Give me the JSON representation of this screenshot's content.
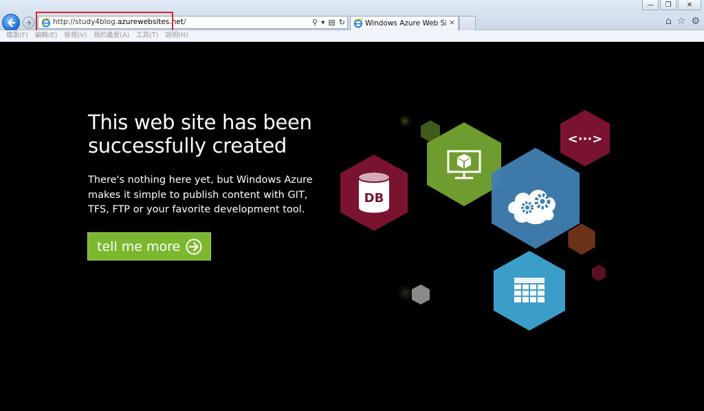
{
  "browser": {
    "url_prefix": "http://study4blog.",
    "url_host": "azurewebsites.net",
    "url_suffix": "/",
    "tab_title": "Windows Azure Web Site ...",
    "tab_close": "×",
    "search_glyph": "⚲",
    "compat_glyph": "▤",
    "refresh_glyph": "↻",
    "window_buttons": {
      "minimize": "—",
      "restore": "❐",
      "close": "✕"
    },
    "toolbar_icons": {
      "home": "⌂",
      "favorites": "☆",
      "tools": "⚙"
    },
    "menu": [
      "檔案(F)",
      "編輯(E)",
      "檢視(V)",
      "我的最愛(A)",
      "工具(T)",
      "說明(H)"
    ]
  },
  "page": {
    "headline": "This web site has been successfully created",
    "description": "There's nothing here yet, but Windows Azure makes it simple to publish content with GIT, TFS, FTP or your favorite development tool.",
    "cta_label": "tell me more",
    "db_label": "DB",
    "code_label": "<···>"
  },
  "colors": {
    "page_bg": "#000000",
    "cta_green": "#7cb82f",
    "hex_green": "#6f9c2f",
    "hex_maroon": "#7a1330",
    "hex_blue": "#3f7fb0",
    "hex_cyan": "#3a9ec9",
    "hex_brown": "#6b3218",
    "highlight_red": "#d8242e"
  }
}
